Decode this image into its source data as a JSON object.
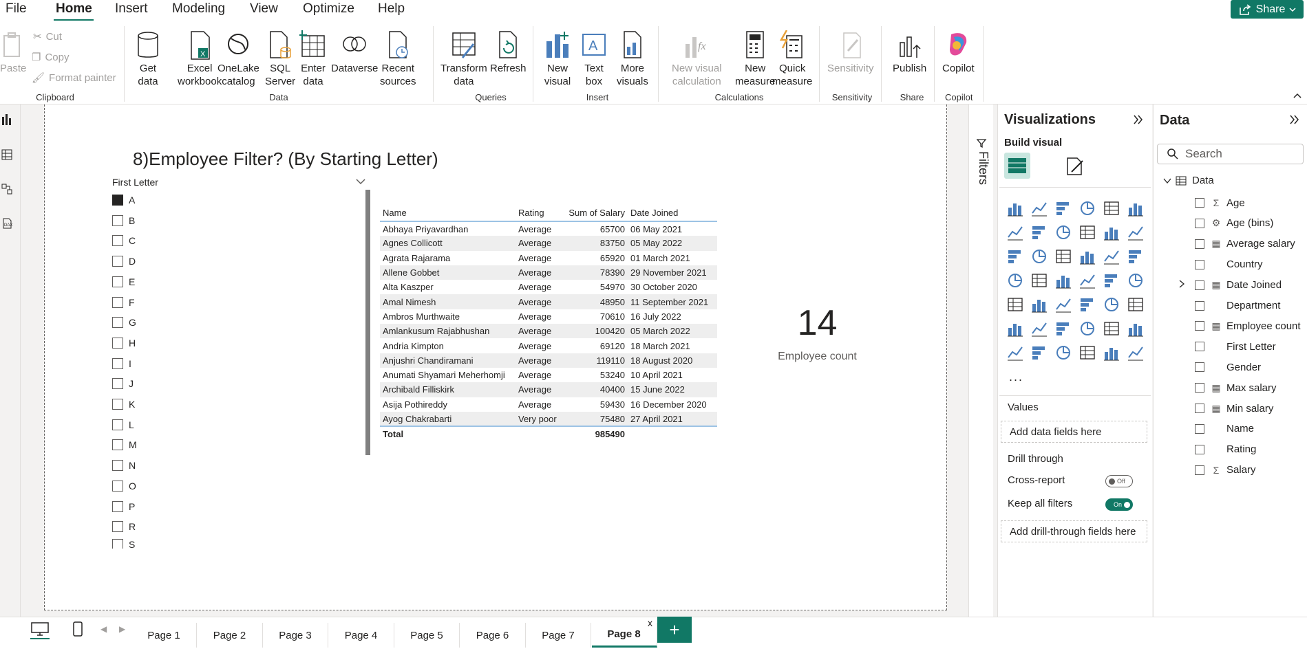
{
  "menu": {
    "items": [
      {
        "label": "File"
      },
      {
        "label": "Home"
      },
      {
        "label": "Insert"
      },
      {
        "label": "Modeling"
      },
      {
        "label": "View"
      },
      {
        "label": "Optimize"
      },
      {
        "label": "Help"
      }
    ],
    "share_label": "Share"
  },
  "ribbon": {
    "clipboard": {
      "paste": "Paste",
      "cut": "Cut",
      "copy": "Copy",
      "format_painter": "Format painter",
      "group": "Clipboard"
    },
    "data": {
      "get_data": [
        "Get",
        "data"
      ],
      "excel": [
        "Excel",
        "workbook"
      ],
      "onelake": [
        "OneLake",
        "catalog"
      ],
      "sql": [
        "SQL",
        "Server"
      ],
      "enter": [
        "Enter",
        "data"
      ],
      "dataverse": [
        "Dataverse",
        ""
      ],
      "recent": [
        "Recent",
        "sources"
      ],
      "group": "Data"
    },
    "queries": {
      "transform": [
        "Transform",
        "data"
      ],
      "refresh": [
        "Refresh",
        ""
      ],
      "group": "Queries"
    },
    "insert": {
      "new_visual": [
        "New",
        "visual"
      ],
      "text_box": [
        "Text",
        "box"
      ],
      "more_visuals": [
        "More",
        "visuals"
      ],
      "group": "Insert"
    },
    "calculations": {
      "new_visual_calc": [
        "New visual",
        "calculation"
      ],
      "new_measure": [
        "New",
        "measure"
      ],
      "quick_measure": [
        "Quick",
        "measure"
      ],
      "group": "Calculations"
    },
    "sensitivity": {
      "label": "Sensitivity",
      "group": "Sensitivity"
    },
    "share": {
      "publish": "Publish",
      "group": "Share"
    },
    "copilot": {
      "label": "Copilot",
      "group": "Copilot"
    }
  },
  "report": {
    "title": "8)Employee Filter? (By Starting Letter)",
    "slicer": {
      "header": "First Letter",
      "items": [
        {
          "label": "A",
          "checked": true
        },
        {
          "label": "B"
        },
        {
          "label": "C"
        },
        {
          "label": "D"
        },
        {
          "label": "E"
        },
        {
          "label": "F"
        },
        {
          "label": "G"
        },
        {
          "label": "H"
        },
        {
          "label": "I"
        },
        {
          "label": "J"
        },
        {
          "label": "K"
        },
        {
          "label": "L"
        },
        {
          "label": "M"
        },
        {
          "label": "N"
        },
        {
          "label": "O"
        },
        {
          "label": "P"
        },
        {
          "label": "R"
        },
        {
          "label": "S"
        }
      ]
    },
    "table": {
      "columns": [
        "Name",
        "Rating",
        "Sum of Salary",
        "Date Joined"
      ],
      "rows": [
        [
          "Abhaya Priyavardhan",
          "Average",
          "65700",
          "06 May 2021"
        ],
        [
          "Agnes Collicott",
          "Average",
          "83750",
          "05 May 2022"
        ],
        [
          "Agrata Rajarama",
          "Average",
          "65920",
          "01 March 2021"
        ],
        [
          "Allene Gobbet",
          "Average",
          "78390",
          "29 November 2021"
        ],
        [
          "Alta Kaszper",
          "Average",
          "54970",
          "30 October 2020"
        ],
        [
          "Amal Nimesh",
          "Average",
          "48950",
          "11 September 2021"
        ],
        [
          "Ambros Murthwaite",
          "Average",
          "70610",
          "16 July 2022"
        ],
        [
          "Amlankusum Rajabhushan",
          "Average",
          "100420",
          "05 March 2022"
        ],
        [
          "Andria Kimpton",
          "Average",
          "69120",
          "18 March 2021"
        ],
        [
          "Anjushri Chandiramani",
          "Average",
          "119110",
          "18 August 2020"
        ],
        [
          "Anumati Shyamari Meherhomji",
          "Average",
          "53240",
          "10 April 2021"
        ],
        [
          "Archibald Filliskirk",
          "Average",
          "40400",
          "15 June 2022"
        ],
        [
          "Asija Pothireddy",
          "Average",
          "59430",
          "16 December 2020"
        ],
        [
          "Ayog Chakrabarti",
          "Very poor",
          "75480",
          "27 April 2021"
        ]
      ],
      "total_label": "Total",
      "total_value": "985490"
    },
    "card": {
      "value": "14",
      "label": "Employee count"
    }
  },
  "filters": {
    "label": "Filters"
  },
  "visualizations": {
    "title": "Visualizations",
    "build_visual": "Build visual",
    "values_label": "Values",
    "values_placeholder": "Add data fields here",
    "drill_through": "Drill through",
    "cross_report": "Cross-report",
    "cross_report_state": "Off",
    "keep_filters": "Keep all filters",
    "keep_filters_state": "On",
    "drill_placeholder": "Add drill-through fields here",
    "more": "..."
  },
  "data_pane": {
    "title": "Data",
    "search_placeholder": "Search",
    "table_name": "Data",
    "fields": [
      {
        "name": "Age",
        "type": "sigma"
      },
      {
        "name": "Age (bins)",
        "type": "bins"
      },
      {
        "name": "Average salary",
        "type": "calc"
      },
      {
        "name": "Country",
        "type": ""
      },
      {
        "name": "Date Joined",
        "type": "calendar"
      },
      {
        "name": "Department",
        "type": ""
      },
      {
        "name": "Employee count",
        "type": "calc"
      },
      {
        "name": "First Letter",
        "type": ""
      },
      {
        "name": "Gender",
        "type": ""
      },
      {
        "name": "Max salary",
        "type": "calc"
      },
      {
        "name": "Min salary",
        "type": "calc"
      },
      {
        "name": "Name",
        "type": ""
      },
      {
        "name": "Rating",
        "type": ""
      },
      {
        "name": "Salary",
        "type": "sigma"
      }
    ]
  },
  "pages": {
    "tabs": [
      "Page 1",
      "Page 2",
      "Page 3",
      "Page 4",
      "Page 5",
      "Page 6",
      "Page 7",
      "Page 8"
    ],
    "active": "Page 8",
    "close_glyph": "x",
    "add_glyph": "+"
  },
  "colors": {
    "accent": "#117865",
    "table_rule": "#9cc3e5"
  }
}
